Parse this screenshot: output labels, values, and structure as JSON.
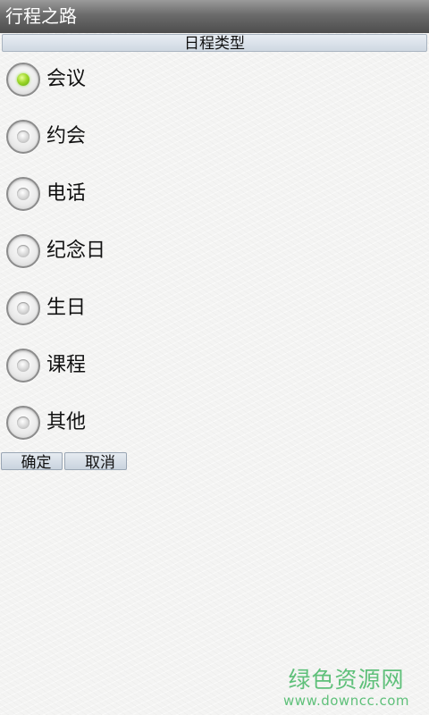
{
  "app": {
    "title": "行程之路"
  },
  "section": {
    "title": "日程类型"
  },
  "options": [
    {
      "label": "会议",
      "checked": true
    },
    {
      "label": "约会",
      "checked": false
    },
    {
      "label": "电话",
      "checked": false
    },
    {
      "label": "纪念日",
      "checked": false
    },
    {
      "label": "生日",
      "checked": false
    },
    {
      "label": "课程",
      "checked": false
    },
    {
      "label": "其他",
      "checked": false
    }
  ],
  "buttons": {
    "confirm": "确定",
    "cancel": "取消"
  },
  "watermark": {
    "brand": "绿色资源网",
    "url": "www.downcc.com",
    "color": "#5fc07a"
  },
  "colors": {
    "selected_radio": "#9fd82a",
    "title_bar": "#5a5a5a"
  }
}
